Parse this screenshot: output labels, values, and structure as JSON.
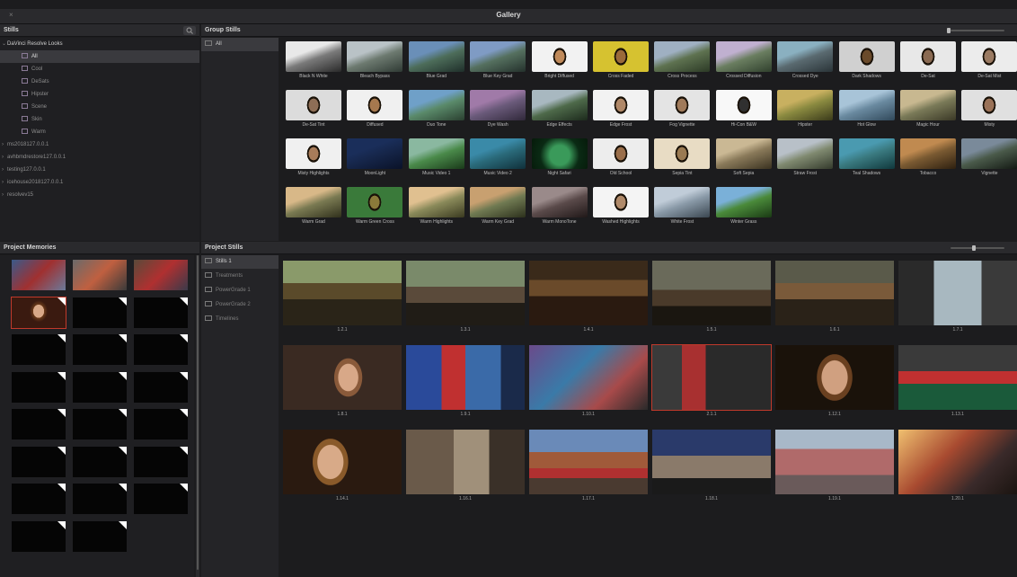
{
  "window": {
    "title": "Gallery",
    "close_glyph": "×"
  },
  "stills_panel": {
    "title": "Stills",
    "tree": [
      {
        "label": "DaVinci Resolve Looks",
        "kind": "root"
      },
      {
        "label": "All",
        "kind": "child",
        "selected": true
      },
      {
        "label": "Cool",
        "kind": "child"
      },
      {
        "label": "DeSats",
        "kind": "child"
      },
      {
        "label": "Hipster",
        "kind": "child"
      },
      {
        "label": "Scene",
        "kind": "child"
      },
      {
        "label": "Skin",
        "kind": "child"
      },
      {
        "label": "Warm",
        "kind": "child"
      },
      {
        "label": "ms2018127.0.0.1",
        "kind": "collapsed"
      },
      {
        "label": "avhbmdrestore127.0.0.1",
        "kind": "collapsed"
      },
      {
        "label": "testing127.0.0.1",
        "kind": "collapsed"
      },
      {
        "label": "icehouse2018127.0.0.1",
        "kind": "collapsed"
      },
      {
        "label": "resolvev15",
        "kind": "collapsed"
      }
    ]
  },
  "group_stills": {
    "title": "Group Stills",
    "sidebar": [
      {
        "label": "All"
      }
    ],
    "looks": [
      {
        "label": "Black N White",
        "style": "bw-mountain"
      },
      {
        "label": "Bleach Bypass",
        "style": "bleach-mountain"
      },
      {
        "label": "Blue Grad",
        "style": "blue-mountain"
      },
      {
        "label": "Blue Key Grad",
        "style": "bluekey-mountain"
      },
      {
        "label": "Bright Diffused",
        "style": "bright-face"
      },
      {
        "label": "Cross Faded",
        "style": "crossfade-face"
      },
      {
        "label": "Cross Process",
        "style": "crossproc-mountain"
      },
      {
        "label": "Crossed Diffusion",
        "style": "crossdiff-mountain"
      },
      {
        "label": "Crossed Dye",
        "style": "dye-mountain"
      },
      {
        "label": "Dark Shadows",
        "style": "dark-face"
      },
      {
        "label": "De-Sat",
        "style": "desat-face"
      },
      {
        "label": "De-Sat Mist",
        "style": "mist-face"
      },
      {
        "label": "De-Sat Tint",
        "style": "tint-face"
      },
      {
        "label": "Diffused",
        "style": "diff-face"
      },
      {
        "label": "Duo Tone",
        "style": "duo-mountain"
      },
      {
        "label": "Dye Wash",
        "style": "dyewash-mountain"
      },
      {
        "label": "Edge Effects",
        "style": "edge-mountain"
      },
      {
        "label": "Edge Frost",
        "style": "frost-face"
      },
      {
        "label": "Fog Vignette",
        "style": "fog-face"
      },
      {
        "label": "Hi-Con B&W",
        "style": "hicon-face"
      },
      {
        "label": "Hipster",
        "style": "hipster-mountain"
      },
      {
        "label": "Hot Glow",
        "style": "hotglow-mountain"
      },
      {
        "label": "Magic Hour",
        "style": "magic-mountain"
      },
      {
        "label": "Misty",
        "style": "misty-face"
      },
      {
        "label": "Misty Highlights",
        "style": "mistyhi-face"
      },
      {
        "label": "MoonLight",
        "style": "moon-mountain"
      },
      {
        "label": "Music Video 1",
        "style": "mv1-mountain"
      },
      {
        "label": "Music Video 2",
        "style": "mv2-mountain"
      },
      {
        "label": "Night Safari",
        "style": "night-mountain"
      },
      {
        "label": "Old School",
        "style": "old-face"
      },
      {
        "label": "Sepia Tint",
        "style": "sepia-face"
      },
      {
        "label": "Soft Sepia",
        "style": "softsepia-mountain"
      },
      {
        "label": "Straw Frost",
        "style": "straw-mountain"
      },
      {
        "label": "Teal Shadows",
        "style": "teal-mountain"
      },
      {
        "label": "Tobacco",
        "style": "tobacco-mountain"
      },
      {
        "label": "Vignette",
        "style": "vignette-mountain"
      },
      {
        "label": "Warm Grad",
        "style": "warm-mountain"
      },
      {
        "label": "Warm Green Cross",
        "style": "greencross-face"
      },
      {
        "label": "Warm Highlights",
        "style": "warmhi-mountain"
      },
      {
        "label": "Warm Key Grad",
        "style": "warmkey-mountain"
      },
      {
        "label": "Warm MonoTone",
        "style": "mono-mountain"
      },
      {
        "label": "Washed Highlights",
        "style": "washed-face"
      },
      {
        "label": "White Frost",
        "style": "whitefrost-mountain"
      },
      {
        "label": "Winter Grass",
        "style": "winter-mountain"
      }
    ]
  },
  "project_memories": {
    "title": "Project Memories"
  },
  "project_stills": {
    "title": "Project Stills",
    "sidebar": [
      {
        "label": "Stills 1",
        "selected": true
      },
      {
        "label": "Treatments"
      },
      {
        "label": "PowerGrade 1"
      },
      {
        "label": "PowerGrade 2"
      },
      {
        "label": "Timelines"
      }
    ],
    "stills": [
      {
        "label": "1.2.1",
        "scene": "office"
      },
      {
        "label": "1.3.1",
        "scene": "office2"
      },
      {
        "label": "1.4.1",
        "scene": "office3"
      },
      {
        "label": "1.5.1",
        "scene": "office4"
      },
      {
        "label": "1.6.1",
        "scene": "office5"
      },
      {
        "label": "1.7.1",
        "scene": "window"
      },
      {
        "label": "1.8.1",
        "scene": "phone"
      },
      {
        "label": "1.9.1",
        "scene": "graffiti-blue"
      },
      {
        "label": "1.10.1",
        "scene": "graffiti-wall"
      },
      {
        "label": "2.1.1",
        "scene": "pool-red"
      },
      {
        "label": "1.12.1",
        "scene": "closeup"
      },
      {
        "label": "1.13.1",
        "scene": "pool"
      },
      {
        "label": "1.14.1",
        "scene": "closeup2"
      },
      {
        "label": "1.16.1",
        "scene": "alley"
      },
      {
        "label": "1.17.1",
        "scene": "balcony"
      },
      {
        "label": "1.18.1",
        "scene": "dusk"
      },
      {
        "label": "1.19.1",
        "scene": "mural"
      },
      {
        "label": "1.20.1",
        "scene": "sunset"
      }
    ]
  },
  "colors": {
    "accent_red": "#c0392b",
    "panel": "#1f1f22",
    "header": "#2a2a2d"
  }
}
